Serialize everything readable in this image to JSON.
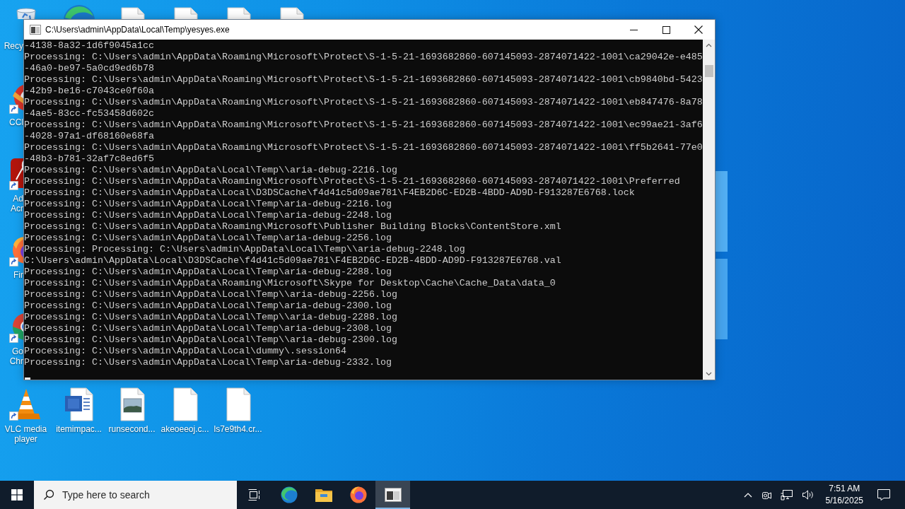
{
  "desktop": {
    "side_icons": [
      {
        "kind": "recycle_bin",
        "label": "Recy"
      },
      {
        "kind": "brush_app",
        "label": "CCl"
      },
      {
        "kind": "document_app",
        "label": "Ad Acr"
      },
      {
        "kind": "fox_browser",
        "label": "Fir"
      },
      {
        "kind": "ring_browser",
        "label": "Go Chr"
      }
    ],
    "bottom_icons": [
      {
        "kind": "cone_app",
        "label": "VLC media player"
      },
      {
        "kind": "word_document",
        "label": "itemimpac..."
      },
      {
        "kind": "image_file",
        "label": "runsecond..."
      },
      {
        "kind": "blank_file",
        "label": "akeoeeoj.c..."
      },
      {
        "kind": "blank_file",
        "label": "ls7e9th4.cr..."
      }
    ]
  },
  "window": {
    "title": "C:\\Users\\admin\\AppData\\Local\\Temp\\yesyes.exe",
    "cursor_visible": true,
    "lines": [
      "-4138-8a32-1d6f9045a1cc",
      "Processing: C:\\Users\\admin\\AppData\\Roaming\\Microsoft\\Protect\\S-1-5-21-1693682860-607145093-2874071422-1001\\ca29042e-e485",
      "-46a0-be97-5a0cd9ed6b78",
      "Processing: C:\\Users\\admin\\AppData\\Roaming\\Microsoft\\Protect\\S-1-5-21-1693682860-607145093-2874071422-1001\\cb9840bd-5423",
      "-42b9-be16-c7043ce0f60a",
      "Processing: C:\\Users\\admin\\AppData\\Roaming\\Microsoft\\Protect\\S-1-5-21-1693682860-607145093-2874071422-1001\\eb847476-8a78",
      "-4ae5-83cc-fc53458d602c",
      "Processing: C:\\Users\\admin\\AppData\\Roaming\\Microsoft\\Protect\\S-1-5-21-1693682860-607145093-2874071422-1001\\ec99ae21-3af6",
      "-4028-97a1-df68160e68fa",
      "Processing: C:\\Users\\admin\\AppData\\Roaming\\Microsoft\\Protect\\S-1-5-21-1693682860-607145093-2874071422-1001\\ff5b2641-77e0",
      "-48b3-b781-32af7c8ed6f5",
      "Processing: C:\\Users\\admin\\AppData\\Local\\Temp\\\\aria-debug-2216.log",
      "Processing: C:\\Users\\admin\\AppData\\Roaming\\Microsoft\\Protect\\S-1-5-21-1693682860-607145093-2874071422-1001\\Preferred",
      "Processing: C:\\Users\\admin\\AppData\\Local\\D3DSCache\\f4d41c5d09ae781\\F4EB2D6C-ED2B-4BDD-AD9D-F913287E6768.lock",
      "Processing: C:\\Users\\admin\\AppData\\Local\\Temp\\aria-debug-2216.log",
      "Processing: C:\\Users\\admin\\AppData\\Local\\Temp\\aria-debug-2248.log",
      "Processing: C:\\Users\\admin\\AppData\\Roaming\\Microsoft\\Publisher Building Blocks\\ContentStore.xml",
      "Processing: C:\\Users\\admin\\AppData\\Local\\Temp\\aria-debug-2256.log",
      "Processing: Processing: C:\\Users\\admin\\AppData\\Local\\Temp\\\\aria-debug-2248.log",
      "C:\\Users\\admin\\AppData\\Local\\D3DSCache\\f4d41c5d09ae781\\F4EB2D6C-ED2B-4BDD-AD9D-F913287E6768.val",
      "Processing: C:\\Users\\admin\\AppData\\Local\\Temp\\aria-debug-2288.log",
      "Processing: C:\\Users\\admin\\AppData\\Roaming\\Microsoft\\Skype for Desktop\\Cache\\Cache_Data\\data_0",
      "Processing: C:\\Users\\admin\\AppData\\Local\\Temp\\\\aria-debug-2256.log",
      "Processing: C:\\Users\\admin\\AppData\\Local\\Temp\\aria-debug-2300.log",
      "Processing: C:\\Users\\admin\\AppData\\Local\\Temp\\\\aria-debug-2288.log",
      "Processing: C:\\Users\\admin\\AppData\\Local\\Temp\\aria-debug-2308.log",
      "Processing: C:\\Users\\admin\\AppData\\Local\\Temp\\\\aria-debug-2300.log",
      "Processing: C:\\Users\\admin\\AppData\\Local\\dummy\\.session64",
      "Processing: C:\\Users\\admin\\AppData\\Local\\Temp\\aria-debug-2332.log"
    ]
  },
  "taskbar": {
    "search": {
      "placeholder": "Type here to search"
    },
    "apps": [
      {
        "kind": "wave_browser",
        "selected": false
      },
      {
        "kind": "folder",
        "selected": false
      },
      {
        "kind": "fox_browser",
        "selected": false
      },
      {
        "kind": "console",
        "selected": true
      }
    ],
    "clock": {
      "time": "7:51 AM",
      "date": "5/16/2025"
    }
  }
}
